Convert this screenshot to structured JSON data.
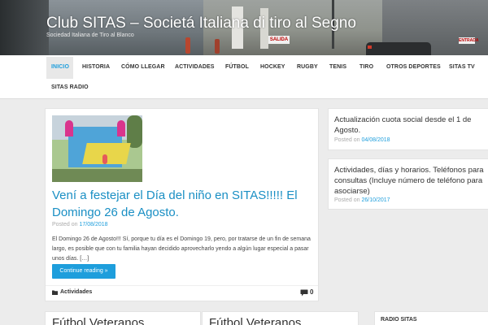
{
  "header": {
    "site_title": "Club SITAS – Societá Italiana di tiro al Segno",
    "site_description": "Sociedad Italiana de Tiro al Blanco",
    "photo_sign_left": "SALIDA",
    "photo_sign_right": "ENTRADA"
  },
  "nav": {
    "items": [
      {
        "label": "INICIO",
        "active": true
      },
      {
        "label": "HISTORIA"
      },
      {
        "label": "CÓMO LLEGAR"
      },
      {
        "label": "ACTIVIDADES"
      },
      {
        "label": "FÚTBOL"
      },
      {
        "label": "HOCKEY"
      },
      {
        "label": "RUGBY"
      },
      {
        "label": "TENIS"
      },
      {
        "label": "TIRO"
      },
      {
        "label": "OTROS DEPORTES"
      },
      {
        "label": "SITAS TV"
      },
      {
        "label": "SITAS RADIO"
      }
    ]
  },
  "post": {
    "title": "Vení a festejar el Día del niño en SITAS!!!!! El Domingo 26 de Agosto.",
    "posted_on_label": "Posted on",
    "date": "17/08/2018",
    "excerpt": "El Domingo 26 de Agosto!!! Sí, porque tu día es el Domingo 19, pero, por tratarse de un fin de semana largo, es posible que con tu familia hayan decidido aprovecharlo yendo a algún lugar especial a pasar unos días. […]",
    "read_more": "Continue reading »",
    "category": "Actividades",
    "comment_count": "0",
    "accent_color": "#1e9edc"
  },
  "sidebar": {
    "posts": [
      {
        "title": "Actualización cuota social desde el 1 de Agosto.",
        "posted_on_label": "Posted on",
        "date": "04/08/2018"
      },
      {
        "title": "Actividades, días y horarios. Teléfonos para consultas (Incluye número de teléfono para asociarse)",
        "posted_on_label": "Posted on",
        "date": "26/10/2017"
      }
    ]
  },
  "bottom": {
    "card1_title": "Fútbol Veteranos",
    "card2_title": "Fútbol Veteranos",
    "radio_title": "RADIO SITAS"
  }
}
